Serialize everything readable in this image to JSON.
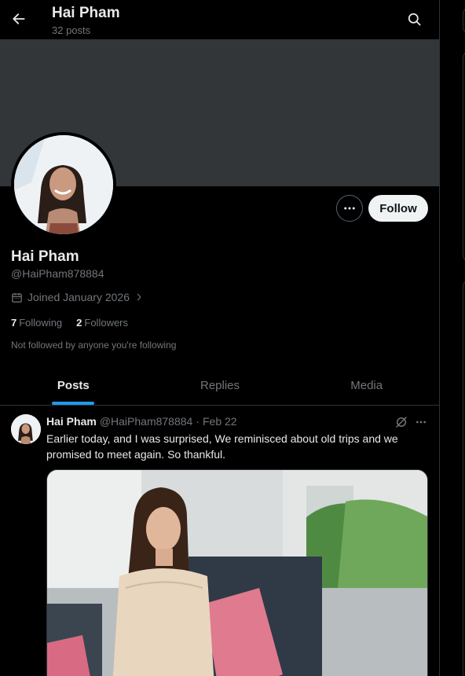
{
  "header": {
    "title": "Hai Pham",
    "post_count": "32 posts"
  },
  "profile": {
    "name": "Hai Pham",
    "handle": "@HaiPham878884",
    "joined": "Joined January 2026",
    "following_count": "7",
    "following_label": "Following",
    "followers_count": "2",
    "followers_label": "Followers",
    "not_followed": "Not followed by anyone you're following",
    "follow_button": "Follow"
  },
  "tabs": [
    {
      "label": "Posts",
      "active": true
    },
    {
      "label": "Replies",
      "active": false
    },
    {
      "label": "Media",
      "active": false
    }
  ],
  "post": {
    "author": "Hai Pham",
    "handle": "@HaiPham878884",
    "separator": "·",
    "date": "Feb 22",
    "text": "Earlier today, and I was surprised, We reminisced about old trips and we promised to meet again. So thankful."
  },
  "colors": {
    "background": "#000000",
    "banner": "#333639",
    "accent": "#1d9bf0",
    "follow_button_bg": "#eff3f4",
    "secondary_text": "#71767b"
  },
  "icons": {
    "back": "arrow-left-icon",
    "search": "search-icon",
    "more": "ellipsis-icon",
    "calendar": "calendar-icon",
    "chevron": "chevron-right-icon",
    "grok": "grok-icon"
  }
}
